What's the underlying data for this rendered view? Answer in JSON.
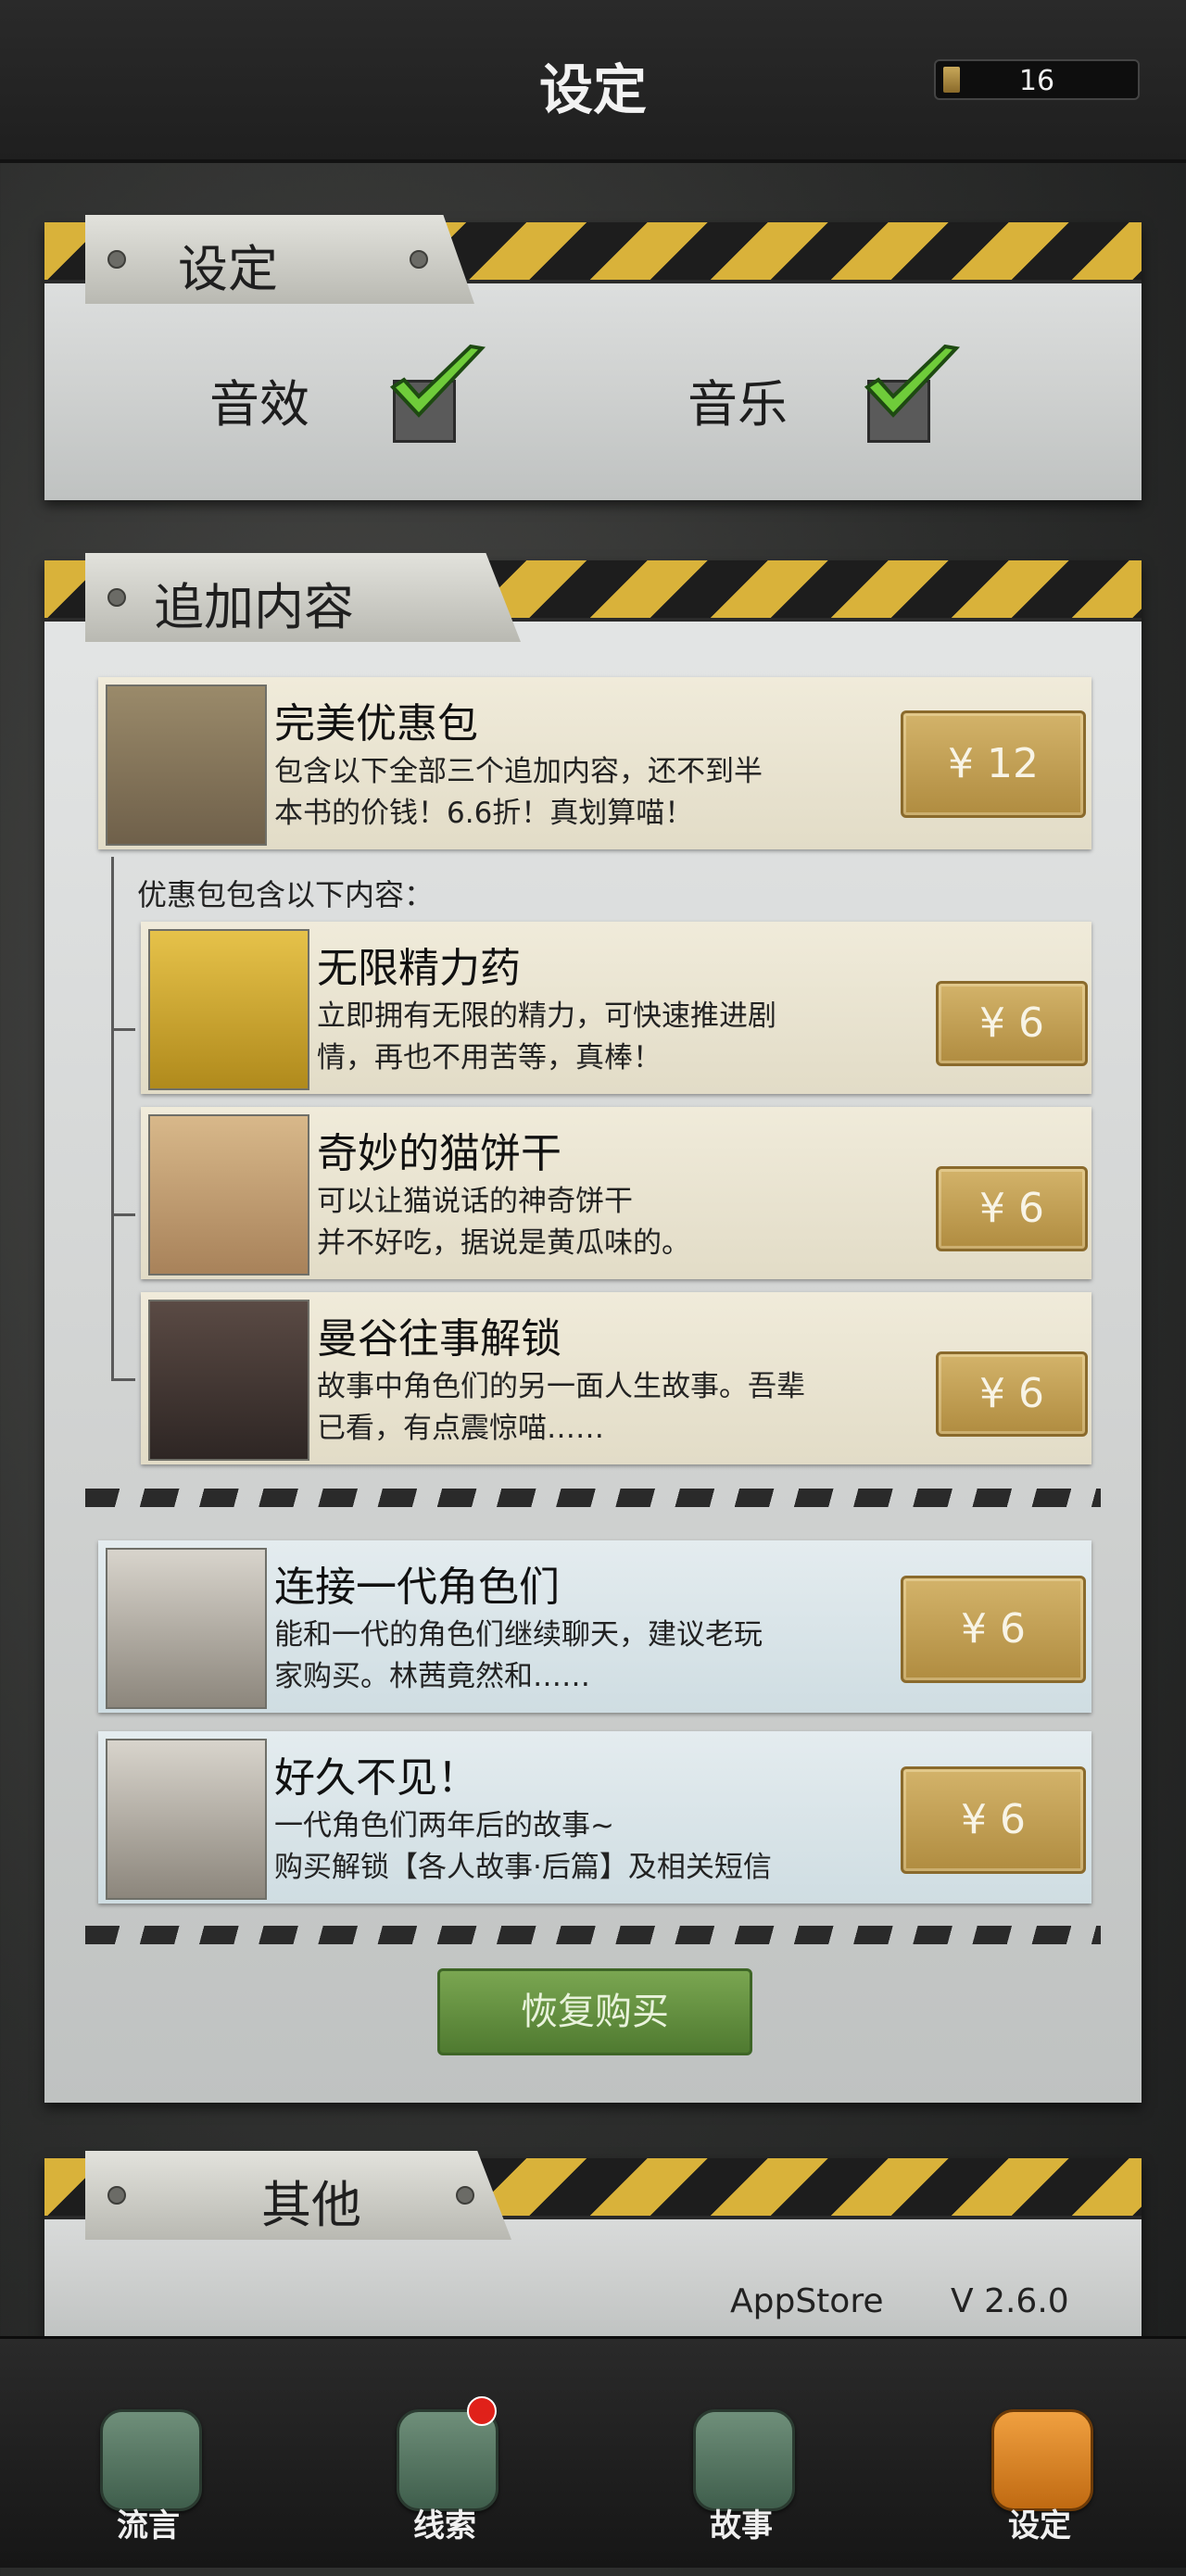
{
  "header": {
    "title": "设定",
    "coin_count": "16"
  },
  "settings_panel": {
    "title": "设定",
    "sound_label": "音效",
    "music_label": "音乐",
    "sound_checked": true,
    "music_checked": true
  },
  "extras_panel": {
    "title": "追加内容",
    "bundle": {
      "name": "完美优惠包",
      "desc": "包含以下全部三个追加内容，还不到半\n本书的价钱！6.6折！真划算喵！",
      "price": "¥ 12"
    },
    "bundle_includes_label": "优惠包包含以下内容：",
    "bundle_items": [
      {
        "name": "无限精力药",
        "desc": "立即拥有无限的精力，可快速推进剧\n情，再也不用苦等，真棒！",
        "price": "¥ 6"
      },
      {
        "name": "奇妙的猫饼干",
        "desc": "可以让猫说话的神奇饼干\n并不好吃，据说是黄瓜味的。",
        "price": "¥ 6"
      },
      {
        "name": "曼谷往事解锁",
        "desc": "故事中角色们的另一面人生故事。吾辈\n已看，有点震惊喵……",
        "price": "¥ 6"
      }
    ],
    "other_items": [
      {
        "name": "连接一代角色们",
        "desc": "能和一代的角色们继续聊天，建议老玩\n家购买。林茜竟然和……",
        "price": "¥ 6"
      },
      {
        "name": "好久不见！",
        "desc": "一代角色们两年后的故事~\n购买解锁【各人故事·后篇】及相关短信",
        "price": "¥ 6"
      }
    ],
    "restore_label": "恢复购买"
  },
  "other_panel": {
    "title": "其他",
    "store": "AppStore",
    "version": "V 2.6.0"
  },
  "tabbar": {
    "tabs": [
      {
        "label": "流言",
        "icon": "chat-bubble-icon",
        "active": false
      },
      {
        "label": "线索",
        "icon": "scroll-icon",
        "active": false,
        "badge": true
      },
      {
        "label": "故事",
        "icon": "temple-icon",
        "active": false
      },
      {
        "label": "设定",
        "icon": "gears-icon",
        "active": true
      }
    ]
  },
  "colors": {
    "hazard_yellow": "#d9b23a",
    "price_gold": "#c3a055",
    "restore_green": "#5f8c3c",
    "active_tab": "#e08a2a"
  }
}
